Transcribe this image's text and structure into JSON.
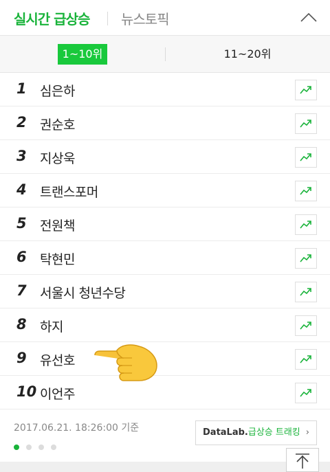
{
  "header": {
    "tab_active": "실시간 급상승",
    "tab_inactive": "뉴스토픽",
    "collapse_icon": "chevron-up-icon"
  },
  "subtabs": {
    "range1": "1~10위",
    "range2": "11~20위"
  },
  "ranking": [
    {
      "rank": "1",
      "keyword": "심은하"
    },
    {
      "rank": "2",
      "keyword": "권순호"
    },
    {
      "rank": "3",
      "keyword": "지상욱"
    },
    {
      "rank": "4",
      "keyword": "트랜스포머"
    },
    {
      "rank": "5",
      "keyword": "전원책"
    },
    {
      "rank": "6",
      "keyword": "탁현민"
    },
    {
      "rank": "7",
      "keyword": "서울시 청년수당"
    },
    {
      "rank": "8",
      "keyword": "하지"
    },
    {
      "rank": "9",
      "keyword": "유선호"
    },
    {
      "rank": "10",
      "keyword": "이언주"
    }
  ],
  "footer": {
    "timestamp": "2017.06.21. 18:26:00 기준",
    "datalab_brand": "DataLab.",
    "datalab_label": "급상승 트래킹",
    "datalab_chevron": "›",
    "page_dots": 4,
    "active_dot": 1
  },
  "colors": {
    "accent": "#19b33a",
    "subtab_active_bg": "#19c93c"
  }
}
